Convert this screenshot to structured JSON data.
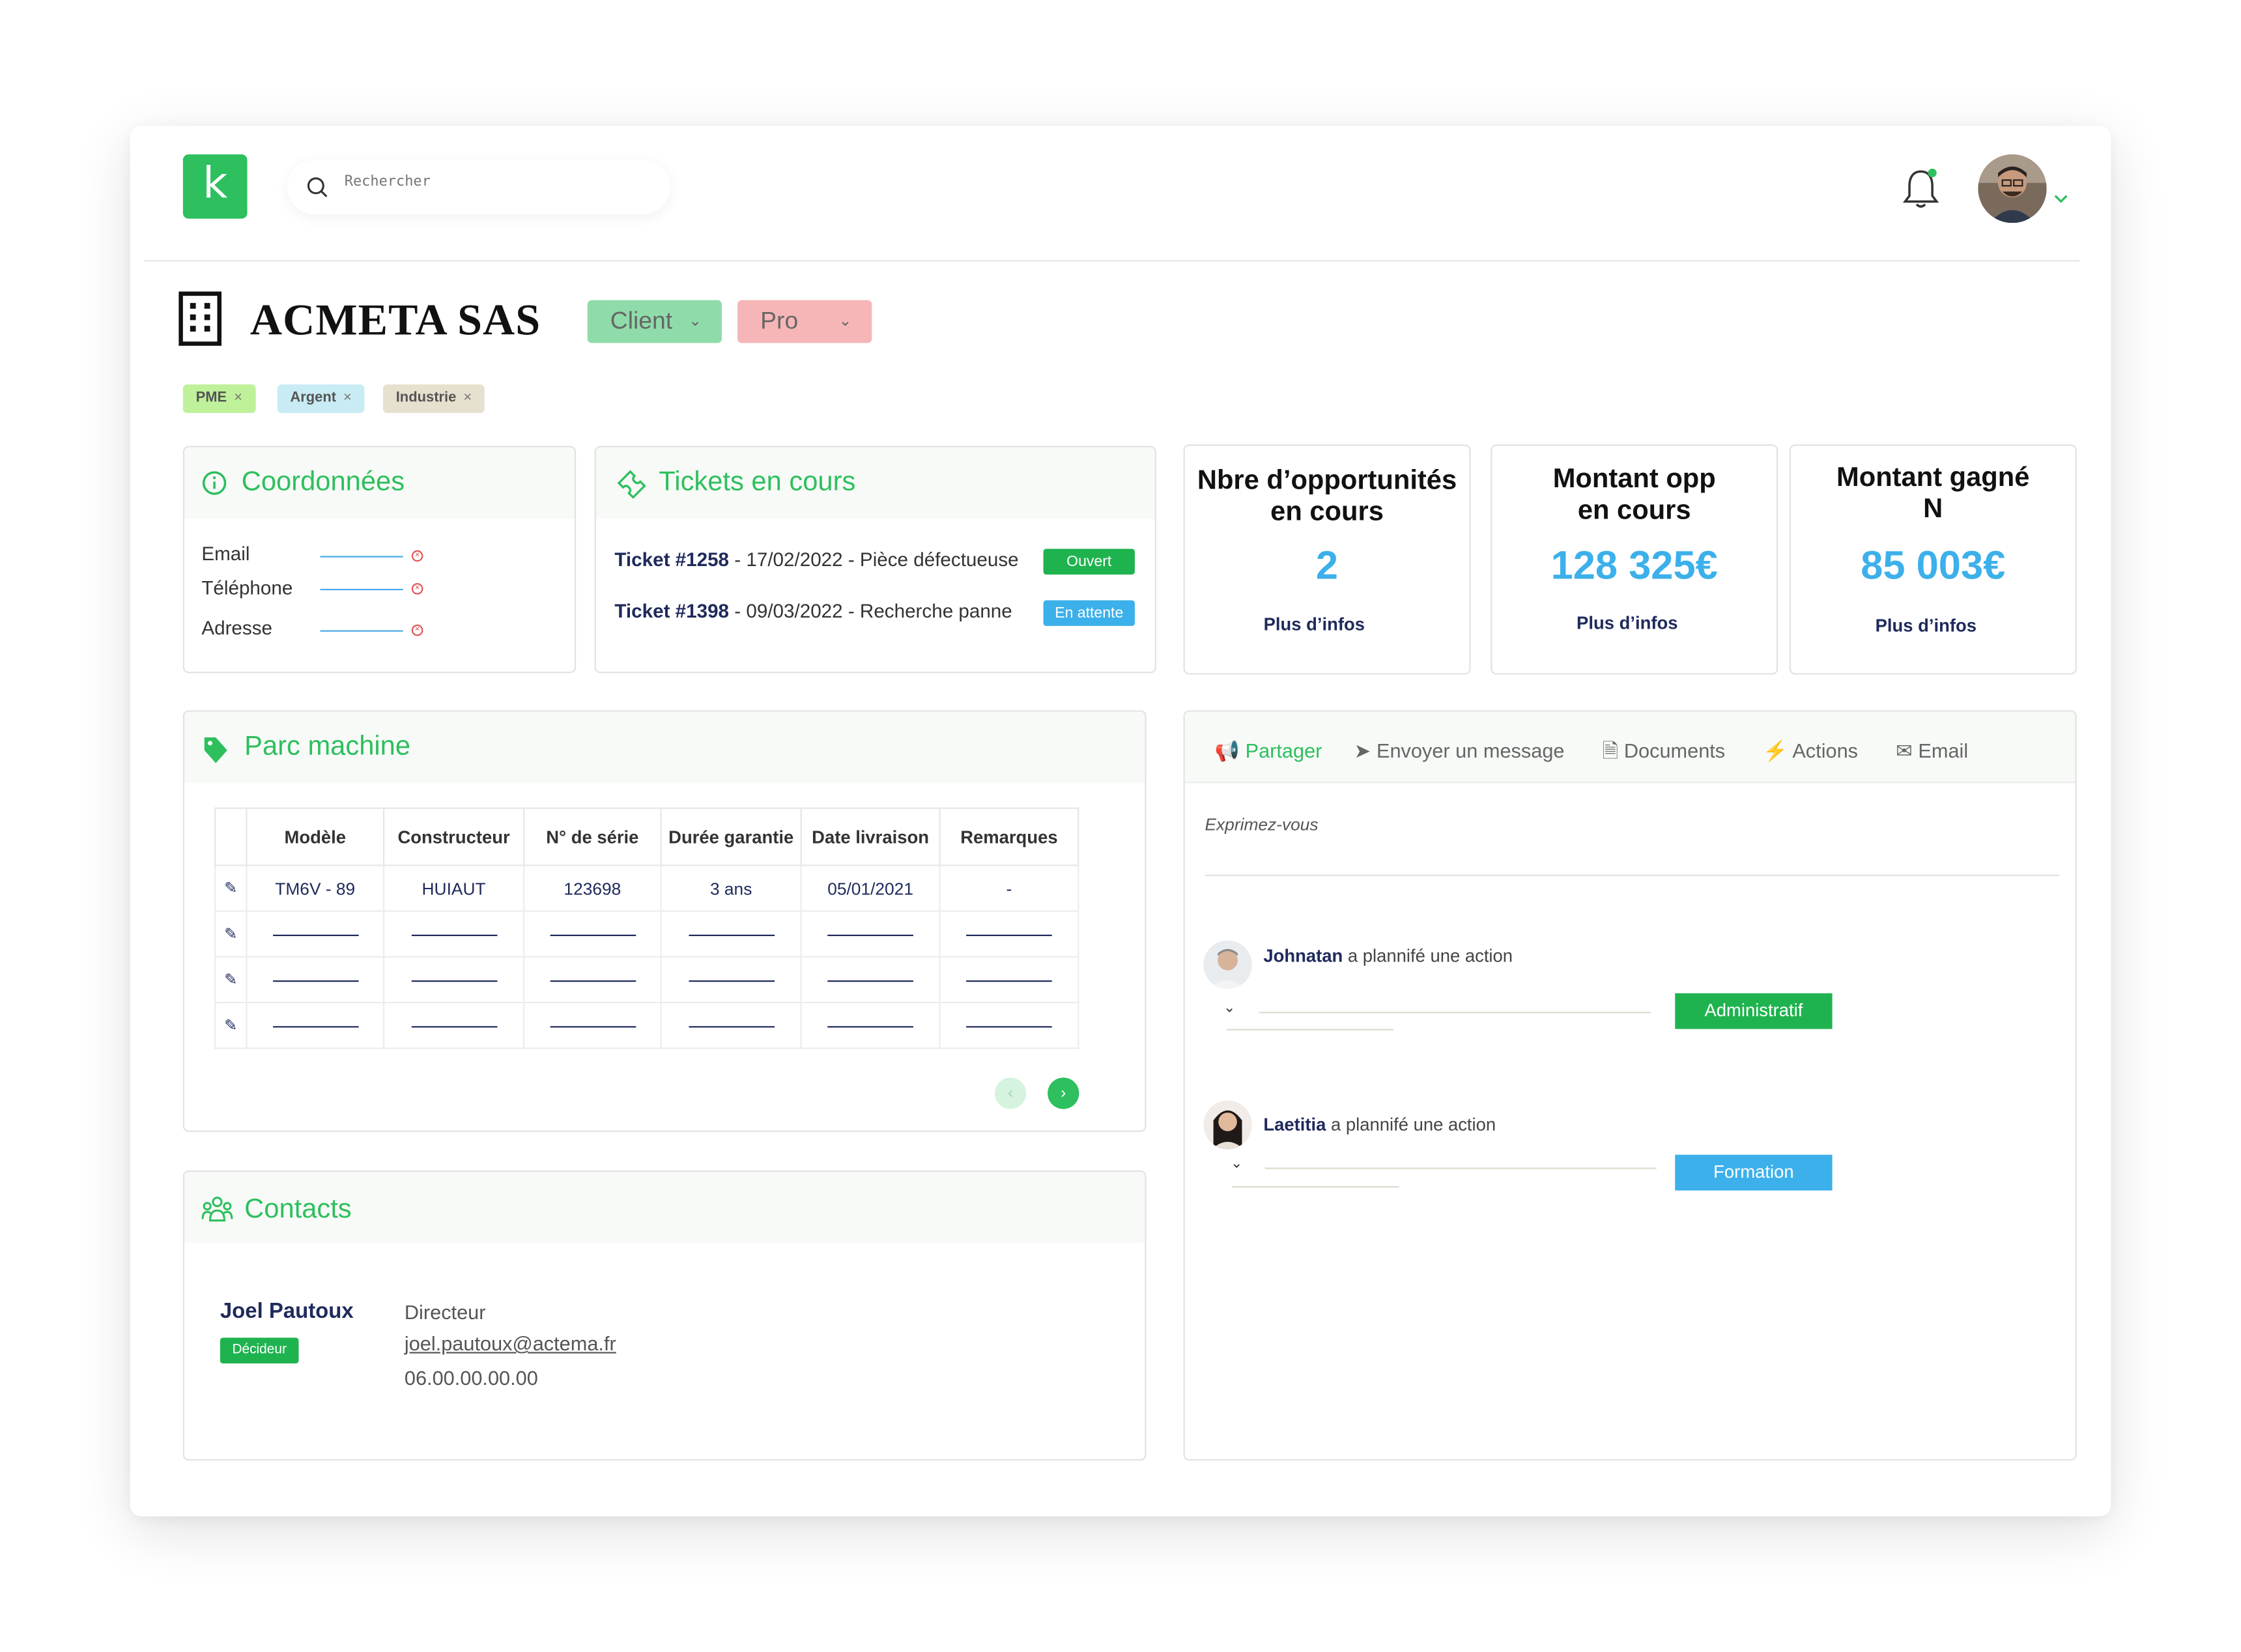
{
  "search": {
    "placeholder": "Rechercher"
  },
  "company": {
    "name": "ACMETA SAS",
    "type_label": "Client",
    "segment_label": "Pro",
    "tags": [
      "PME",
      "Argent",
      "Industrie"
    ]
  },
  "coordonnees": {
    "title": "Coordonnées",
    "fields": [
      "Email",
      "Téléphone",
      "Adresse"
    ]
  },
  "tickets": {
    "title": "Tickets en cours",
    "items": [
      {
        "ref": "Ticket  #1258",
        "detail": " - 17/02/2022 - Pièce défectueuse",
        "status": "Ouvert"
      },
      {
        "ref": "Ticket  #1398",
        "detail": " - 09/03/2022 - Recherche panne",
        "status": "En attente"
      }
    ]
  },
  "stats": [
    {
      "title_line1": "Nbre d’opportunités",
      "title_line2": "en cours",
      "value": "2",
      "more": "Plus d’infos"
    },
    {
      "title_line1": "Montant opp",
      "title_line2": "en cours",
      "value": "128 325€",
      "more": "Plus d’infos"
    },
    {
      "title_line1": "Montant gagné",
      "title_line2": "N",
      "value": "85 003€",
      "more": "Plus d’infos"
    }
  ],
  "parc": {
    "title": "Parc machine",
    "columns": [
      "Modèle",
      "Constructeur",
      "N° de série",
      "Durée garantie",
      "Date livraison",
      "Remarques"
    ],
    "row1": [
      "TM6V - 89",
      "HUIAUT",
      "123698",
      "3 ans",
      "05/01/2021",
      "-"
    ]
  },
  "contacts": {
    "title": "Contacts",
    "name": "Joel Pautoux",
    "badge": "Décideur",
    "role": "Directeur",
    "email": "joel.pautoux@actema.fr",
    "phone": "06.00.00.00.00"
  },
  "activity": {
    "tabs": [
      "Partager",
      "Envoyer un message",
      "Documents",
      "Actions",
      "Email"
    ],
    "compose_placeholder": "Exprimez-vous",
    "feed": [
      {
        "user": "Johnatan",
        "text": " a plannifé une action",
        "tag": "Administratif"
      },
      {
        "user": "Laetitia",
        "text": " a plannifé une action",
        "tag": "Formation"
      }
    ]
  },
  "colors": {
    "brand": "#2ebf5e",
    "blue": "#3cb0ea",
    "navy": "#1f2a5c",
    "client": "#8fdcaa",
    "pro": "#f6b6b8"
  }
}
